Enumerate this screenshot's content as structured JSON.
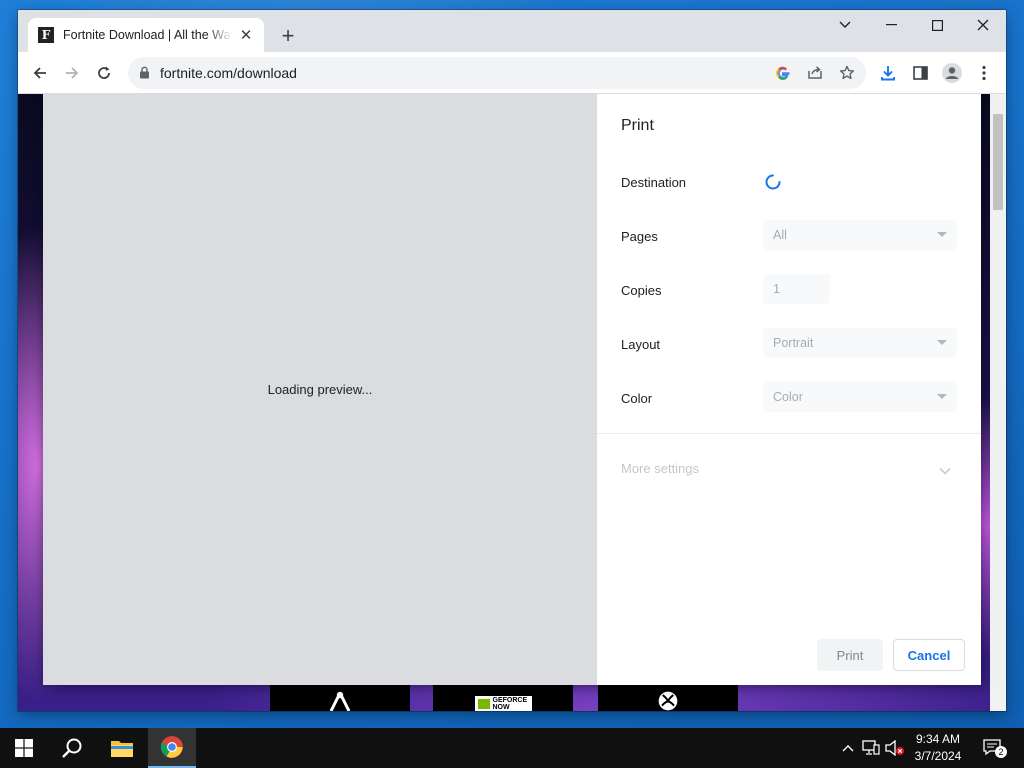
{
  "browser": {
    "tab": {
      "title": "Fortnite Download | All the Ways to Play",
      "favicon_letter": "F"
    },
    "url": "fortnite.com/download"
  },
  "print_dialog": {
    "preview_status": "Loading preview...",
    "title": "Print",
    "rows": {
      "destination": {
        "label": "Destination"
      },
      "pages": {
        "label": "Pages",
        "value": "All"
      },
      "copies": {
        "label": "Copies",
        "value": "1"
      },
      "layout": {
        "label": "Layout",
        "value": "Portrait"
      },
      "color": {
        "label": "Color",
        "value": "Color"
      }
    },
    "more_settings": "More settings",
    "print_button": "Print",
    "cancel_button": "Cancel"
  },
  "page_bg": {
    "geforce_logo_text": "GEFORCE NOW"
  },
  "taskbar": {
    "time": "9:34 AM",
    "date": "3/7/2024",
    "notification_count": "2"
  },
  "colors": {
    "accent": "#1a73e8",
    "spinner": "#1a73e8",
    "taskbar": "#101010"
  }
}
